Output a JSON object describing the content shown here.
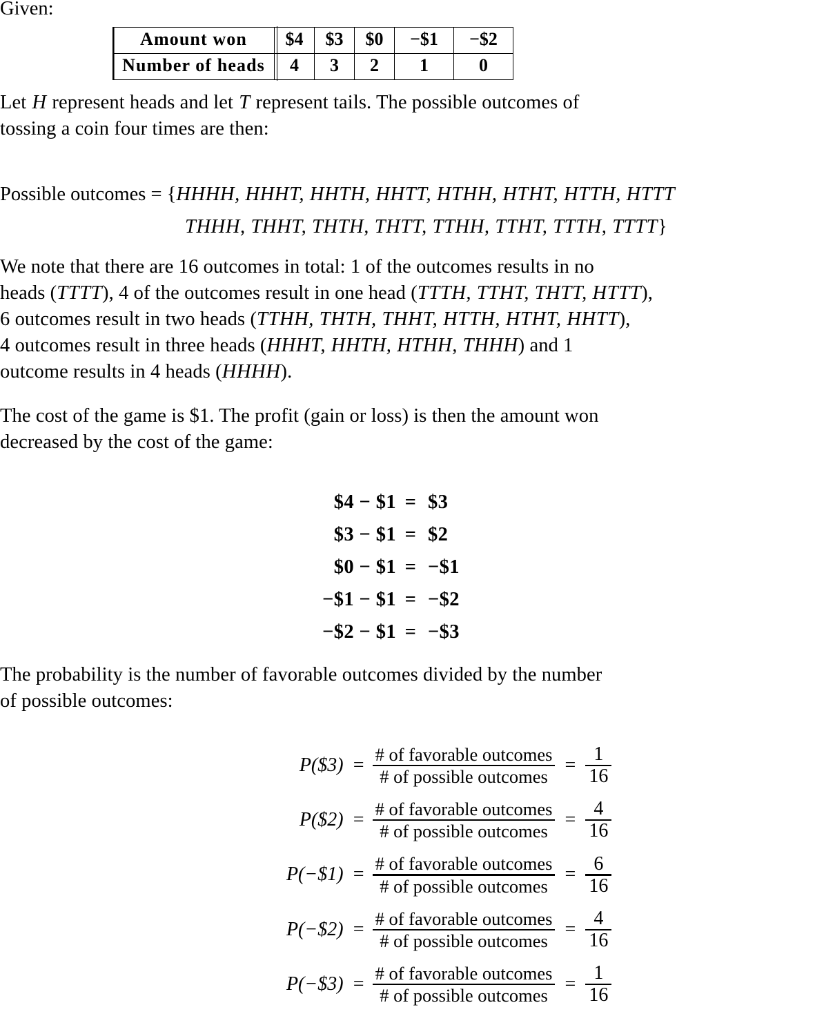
{
  "given_label": "Given:",
  "table": {
    "rows": [
      {
        "header": "Amount won",
        "cells": [
          "$4",
          "$3",
          "$0",
          "−$1",
          "−$2"
        ]
      },
      {
        "header": "Number of heads",
        "cells": [
          "4",
          "3",
          "2",
          "1",
          "0"
        ]
      }
    ]
  },
  "intro": {
    "line1_a": "Let ",
    "var_h": "H",
    "line1_b": " represent heads and let ",
    "var_t": "T",
    "line1_c": " represent tails.  The possible outcomes of",
    "line2": "tossing a coin four times are then:"
  },
  "outcomes": {
    "lead": "Possible outcomes = {",
    "line1_items": "HHHH, HHHT, HHTH, HHTT, HTHH, HTHT, HTTH, HTTT",
    "line2_items": "THHH, THHT, THTH, THTT, TTHH, TTHT, TTTH, TTTT",
    "close": "}"
  },
  "note": {
    "l1": "We note that there are 16 outcomes in total:  1 of the outcomes results in no",
    "l2_a": "heads (",
    "l2_m1": "TTTT",
    "l2_b": "), 4 of the outcomes result in one head (",
    "l2_m2": "TTTH, TTHT, THTT, HTTT",
    "l2_c": "),",
    "l3_a": "6 outcomes result in two heads (",
    "l3_m1": "TTHH, THTH, THHT, HTTH, HTHT, HHTT",
    "l3_b": "),",
    "l4_a": "4 outcomes result in three heads (",
    "l4_m1": "HHHT, HHTH, HTHH, THHH",
    "l4_b": ") and 1",
    "l5_a": "outcome results in 4 heads (",
    "l5_m1": "HHHH",
    "l5_b": ")."
  },
  "cost": {
    "l1": "The cost of the game is $1.  The profit (gain or loss) is then the amount won",
    "l2": "decreased by the cost of the game:"
  },
  "equations": [
    {
      "lhs": "$4 − $1",
      "op": "=",
      "rhs": "$3"
    },
    {
      "lhs": "$3 − $1",
      "op": "=",
      "rhs": "$2"
    },
    {
      "lhs": "$0 − $1",
      "op": "=",
      "rhs": "−$1"
    },
    {
      "lhs": "−$1 − $1",
      "op": "=",
      "rhs": "−$2"
    },
    {
      "lhs": "−$2 − $1",
      "op": "=",
      "rhs": "−$3"
    }
  ],
  "prob_intro": {
    "l1": "The probability is the number of favorable outcomes divided by the number",
    "l2": "of possible outcomes:"
  },
  "fraction_labels": {
    "numerator": "# of favorable outcomes",
    "denominator": "# of possible outcomes",
    "equals": "="
  },
  "probabilities": [
    {
      "label": "P($3)",
      "eq1": "=",
      "eq2": "=",
      "num": "1",
      "den": "16"
    },
    {
      "label": "P($2)",
      "eq1": "=",
      "eq2": "=",
      "num": "4",
      "den": "16"
    },
    {
      "label": "P(−$1)",
      "eq1": "=",
      "eq2": "=",
      "num": "6",
      "den": "16"
    },
    {
      "label": "P(−$2)",
      "eq1": "=",
      "eq2": "=",
      "num": "4",
      "den": "16"
    },
    {
      "label": "P(−$3)",
      "eq1": "=",
      "eq2": "=",
      "num": "1",
      "den": "16"
    }
  ]
}
